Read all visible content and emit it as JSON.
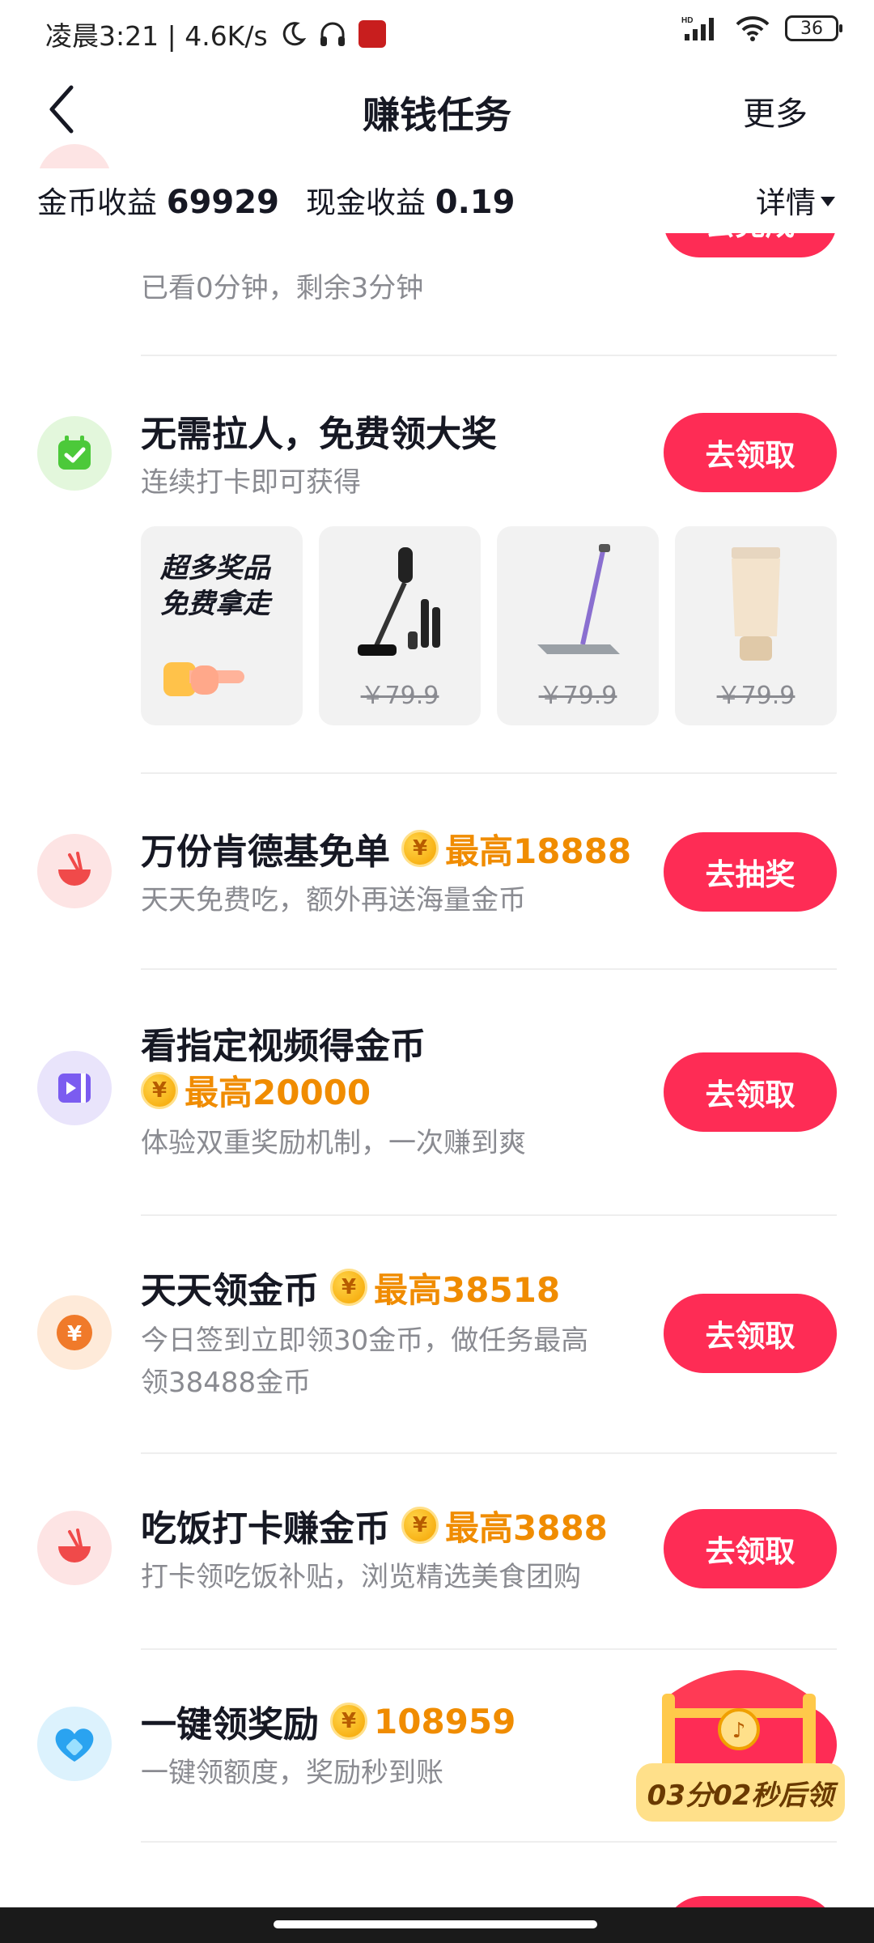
{
  "status_bar": {
    "time_and_speed": "凌晨3:21 | 4.6K/s",
    "battery": "36"
  },
  "nav": {
    "title": "赚钱任务",
    "more_label": "更多"
  },
  "earnings": {
    "coin_label": "金币收益",
    "coin_value": "69929",
    "cash_label": "现金收益",
    "cash_value": "0.19",
    "detail_label": "详情"
  },
  "tasks": [
    {
      "subtitle": "已看0分钟，剩余3分钟",
      "button": "去完成"
    },
    {
      "title": "无需拉人，免费领大奖",
      "subtitle": "连续打卡即可获得",
      "button": "去领取",
      "icon": "calendar-check-icon",
      "promo_line1": "超多奖品",
      "promo_line2": "免费拿走",
      "prizes": [
        {
          "name": "vacuum",
          "price": "￥79.9"
        },
        {
          "name": "mop",
          "price": "￥79.9"
        },
        {
          "name": "cream",
          "price": "￥79.9"
        }
      ]
    },
    {
      "title": "万份肯德基免单",
      "reward": "最高18888",
      "subtitle": "天天免费吃，额外再送海量金币",
      "button": "去抽奖",
      "icon": "bowl-icon"
    },
    {
      "title": "看指定视频得金币",
      "reward": "最高20000",
      "subtitle": "体验双重奖励机制，一次赚到爽",
      "button": "去领取",
      "icon": "video-icon"
    },
    {
      "title": "天天领金币",
      "reward": "最高38518",
      "subtitle_line1": "今日签到立即领30金币，做任务最高",
      "subtitle_line2": "领38488金币",
      "button": "去领取",
      "icon": "yuan-coin-icon"
    },
    {
      "title": "吃饭打卡赚金币",
      "reward": "最高3888",
      "subtitle": "打卡领吃饭补贴，浏览精选美食团购",
      "button": "去领取",
      "icon": "bowl-icon"
    },
    {
      "title": "一键领奖励",
      "reward": "108959",
      "subtitle": "一键领额度，奖励秒到账",
      "icon": "heart-icon"
    }
  ],
  "coin_symbol": "¥",
  "chest_timer": "03分02秒后领",
  "colors": {
    "accent": "#fe2c55",
    "reward": "#f08c00"
  }
}
